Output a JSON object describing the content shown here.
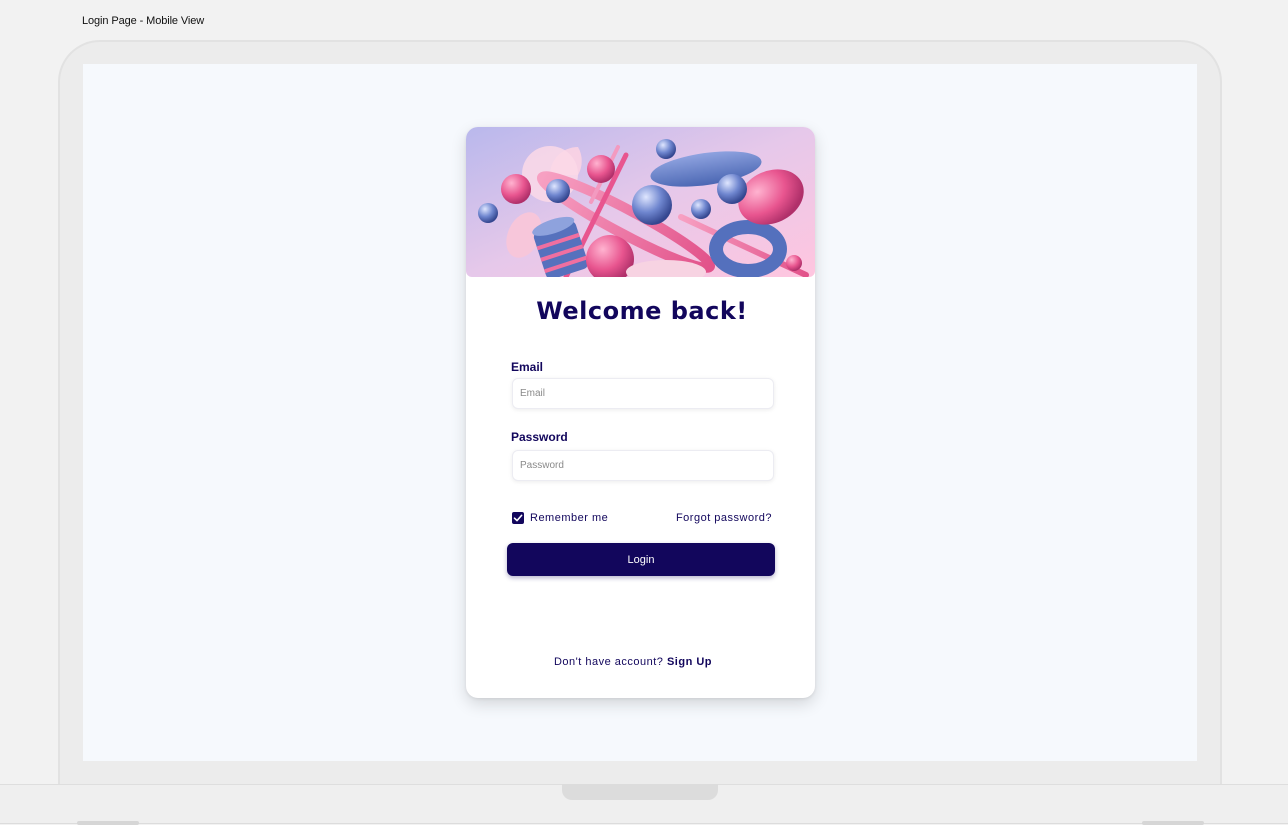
{
  "frame": {
    "caption": "Login Page - Mobile View"
  },
  "login": {
    "title": "Welcome back!",
    "email": {
      "label": "Email",
      "placeholder": "Email",
      "value": ""
    },
    "password": {
      "label": "Password",
      "placeholder": "Password",
      "value": ""
    },
    "remember": {
      "label": "Remember me",
      "checked": true
    },
    "forgot_label": "Forgot password?",
    "login_label": "Login",
    "signup_prompt": "Don't have account?",
    "signup_label": "Sign Up"
  },
  "theme": {
    "primary": "#12065c",
    "screen_background": "#f6f9fd",
    "hero_pink": "#e8558f",
    "hero_blue": "#4b67b3"
  }
}
